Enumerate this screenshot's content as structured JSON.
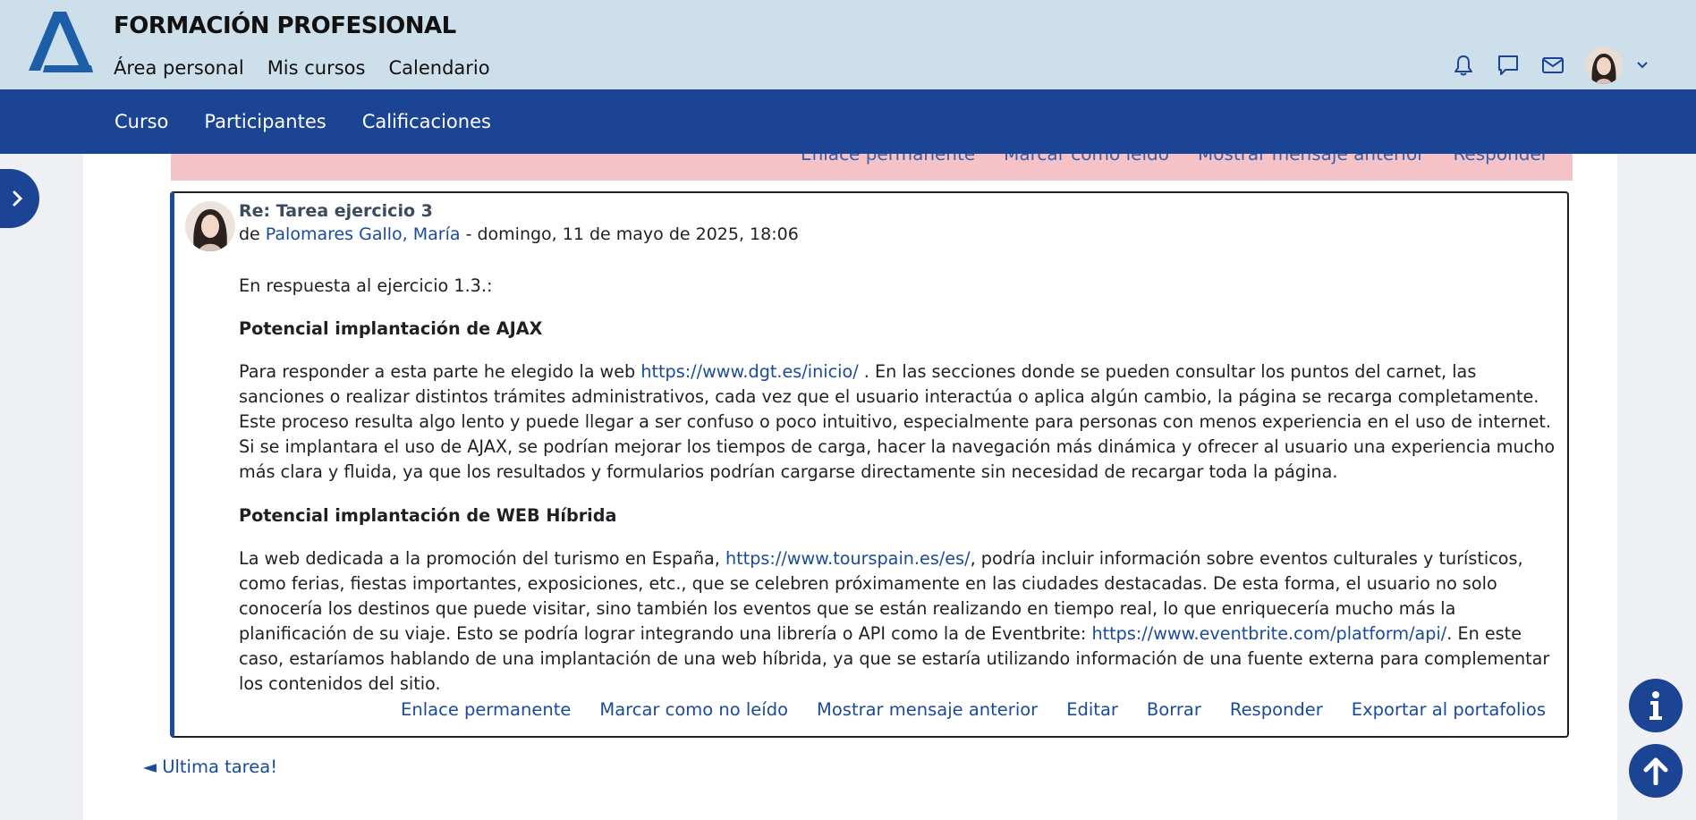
{
  "colors": {
    "topbar_bg": "#cddfea",
    "brand_blue": "#1c4494",
    "link": "#1a4a9c",
    "unread_bg": "#f5c2c8"
  },
  "header": {
    "site_title": "FORMACIÓN PROFESIONAL",
    "nav": [
      {
        "label": "Área personal"
      },
      {
        "label": "Mis cursos"
      },
      {
        "label": "Calendario"
      }
    ],
    "icons": [
      "bell-icon",
      "chat-icon",
      "mail-icon",
      "avatar",
      "chevron-down-icon"
    ]
  },
  "course_nav": [
    {
      "label": "Curso"
    },
    {
      "label": "Participantes"
    },
    {
      "label": "Calificaciones"
    }
  ],
  "previous_post": {
    "actions": [
      "Enlace permanente",
      "Marcar como leído",
      "Mostrar mensaje anterior",
      "Responder"
    ]
  },
  "post": {
    "subject": "Re: Tarea ejercicio 3",
    "by_prefix": "de ",
    "author": "Palomares Gallo, María",
    "date_sep": " - ",
    "date": "domingo, 11 de mayo de 2025, 18:06",
    "intro": "En respuesta al ejercicio 1.3.:",
    "section1_title": "Potencial implantación de AJAX",
    "section1_pre": "Para responder a esta parte he elegido la web ",
    "section1_link": "https://www.dgt.es/inicio/",
    "section1_post": " . En las secciones donde se pueden consultar los puntos del carnet, las sanciones o realizar distintos trámites administrativos, cada vez que el usuario interactúa o aplica algún cambio, la página se recarga completamente. Este proceso resulta algo lento y puede llegar a ser confuso o poco intuitivo, especialmente para personas con menos experiencia en el uso de internet. Si se implantara el uso de AJAX, se podrían mejorar los tiempos de carga, hacer la navegación más dinámica y ofrecer al usuario una experiencia mucho más clara y fluida, ya que los resultados y formularios podrían cargarse directamente sin necesidad de recargar toda la página.",
    "section2_title": "Potencial implantación de WEB Híbrida",
    "section2_pre": "La web dedicada a la promoción del turismo en España, ",
    "section2_link1": "https://www.tourspain.es/es/",
    "section2_mid": ", podría incluir información sobre eventos culturales y turísticos, como ferias, fiestas importantes, exposiciones, etc., que se celebren próximamente en las ciudades destacadas. De esta forma, el usuario no solo conocería los destinos que puede visitar, sino también los eventos que se están realizando en tiempo real, lo que enriquecería mucho más la planificación de su viaje. Esto se podría lograr integrando una librería o API como la de Eventbrite: ",
    "section2_link2": "https://www.eventbrite.com/platform/api/",
    "section2_post": ". En este caso, estaríamos hablando de una implantación de una web híbrida, ya que se estaría utilizando información de una fuente externa para complementar los contenidos del sitio.",
    "actions": [
      {
        "label": "Enlace permanente"
      },
      {
        "label": "Marcar como no leído"
      },
      {
        "label": "Mostrar mensaje anterior"
      },
      {
        "label": "Editar"
      },
      {
        "label": "Borrar"
      },
      {
        "label": "Responder"
      },
      {
        "label": "Exportar al portafolios"
      }
    ]
  },
  "back_link": "◄ Ultima tarea!",
  "floating": [
    "info-icon",
    "arrow-up-icon"
  ]
}
